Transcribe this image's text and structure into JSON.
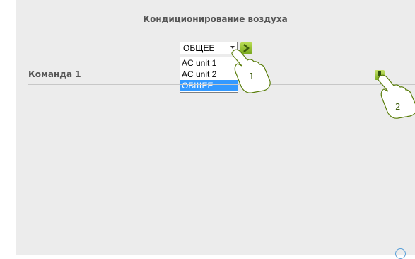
{
  "header": {
    "title": "Кондиционирование воздуха"
  },
  "selector": {
    "current_value": "ОБЩЕЕ",
    "options": [
      "AC unit 1",
      "AC unit 2",
      "ОБЩЕЕ"
    ]
  },
  "rows": [
    {
      "label": "Команда 1"
    }
  ],
  "callouts": [
    {
      "number": "1"
    },
    {
      "number": "2"
    }
  ],
  "colors": {
    "accent_green": "#8bbd2a",
    "selection_blue": "#3399ff",
    "panel_bg": "#ececec"
  },
  "icons": {
    "go": "arrow-right-icon",
    "command": "command-icon",
    "help": "help-icon"
  }
}
